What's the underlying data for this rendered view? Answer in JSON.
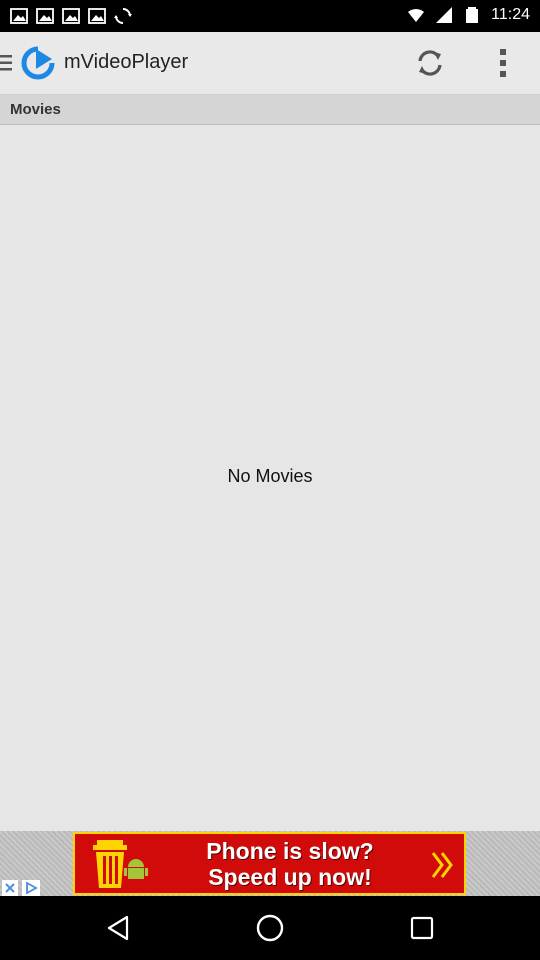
{
  "status_bar": {
    "time": "11:24",
    "left_icons": [
      "picture-icon",
      "picture-icon",
      "picture-icon",
      "picture-icon",
      "sync-icon"
    ],
    "right_icons": [
      "wifi-icon",
      "signal-icon",
      "battery-icon"
    ]
  },
  "app_bar": {
    "title": "mVideoPlayer",
    "refresh_icon": "refresh-icon",
    "overflow_icon": "more-vert-icon"
  },
  "section": {
    "title": "Movies"
  },
  "empty_state": {
    "message": "No Movies"
  },
  "ad": {
    "text_line1": "Phone is slow?",
    "text_line2": "Speed up now!",
    "accent_color": "#d10a0a",
    "border_color": "#ffd400"
  },
  "nav_bar": {
    "icons": [
      "back-icon",
      "home-icon",
      "recents-icon"
    ]
  }
}
